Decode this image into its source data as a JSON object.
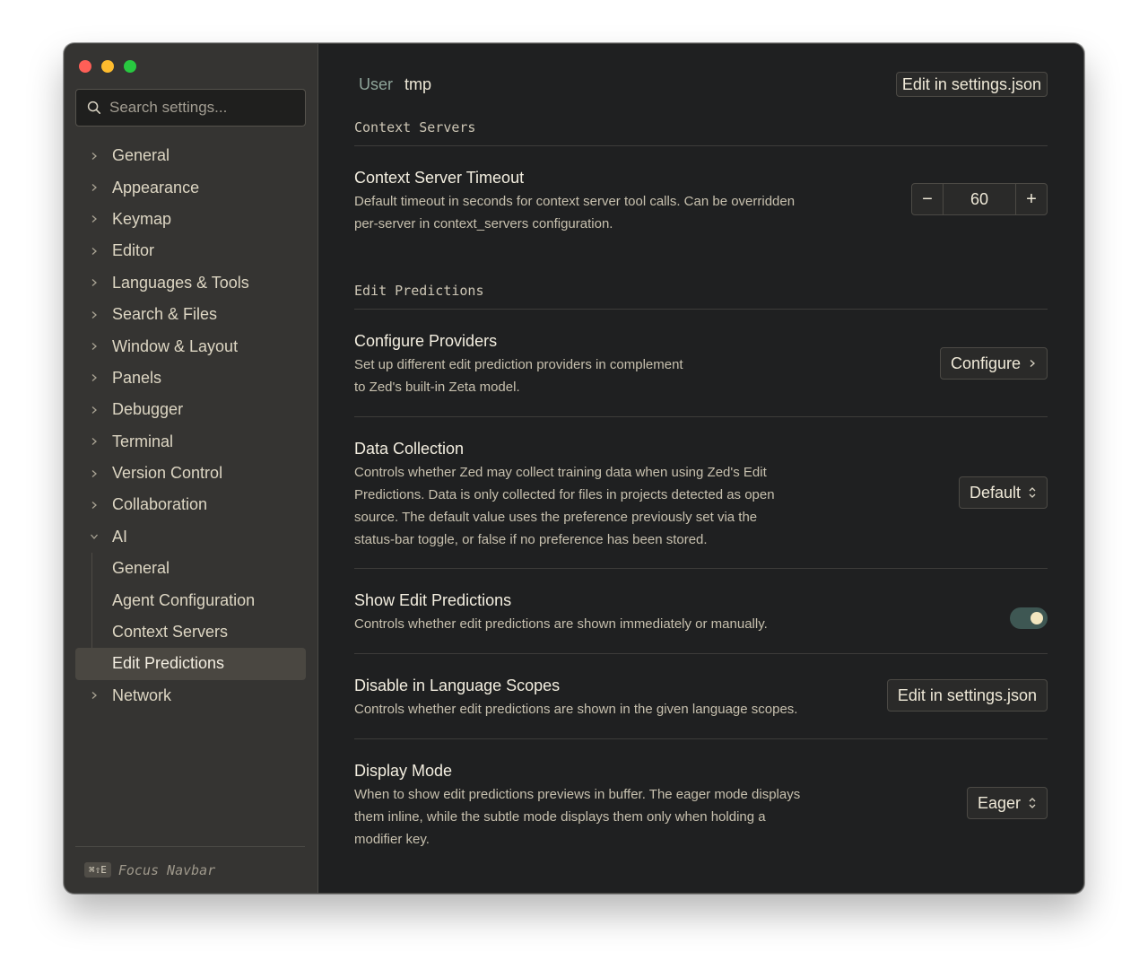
{
  "window": {
    "traffic_lights": [
      "close",
      "minimize",
      "maximize"
    ]
  },
  "sidebar": {
    "search_placeholder": "Search settings...",
    "items": [
      {
        "label": "General",
        "expanded": false
      },
      {
        "label": "Appearance",
        "expanded": false
      },
      {
        "label": "Keymap",
        "expanded": false
      },
      {
        "label": "Editor",
        "expanded": false
      },
      {
        "label": "Languages & Tools",
        "expanded": false
      },
      {
        "label": "Search & Files",
        "expanded": false
      },
      {
        "label": "Window & Layout",
        "expanded": false
      },
      {
        "label": "Panels",
        "expanded": false
      },
      {
        "label": "Debugger",
        "expanded": false
      },
      {
        "label": "Terminal",
        "expanded": false
      },
      {
        "label": "Version Control",
        "expanded": false
      },
      {
        "label": "Collaboration",
        "expanded": false
      },
      {
        "label": "AI",
        "expanded": true
      },
      {
        "label": "Network",
        "expanded": false
      }
    ],
    "ai_children": [
      {
        "label": "General"
      },
      {
        "label": "Agent Configuration"
      },
      {
        "label": "Context Servers"
      },
      {
        "label": "Edit Predictions",
        "active": true
      }
    ],
    "footer": {
      "shortcut": "⌘⇧E",
      "label": "Focus Navbar"
    }
  },
  "main": {
    "breadcrumb": {
      "scope": "User",
      "project": "tmp"
    },
    "header_button": "Edit in settings.json",
    "sections": [
      {
        "title": "Context Servers"
      },
      {
        "title": "Edit Predictions"
      }
    ],
    "settings": {
      "context_server_timeout": {
        "title": "Context Server Timeout",
        "description_lines": [
          "Default timeout in seconds for context server tool calls. Can be overridden",
          "per-server in context_servers configuration."
        ],
        "value": "60",
        "minus": "−",
        "plus": "+"
      },
      "configure_providers": {
        "title": "Configure Providers",
        "description_lines": [
          "Set up different edit prediction providers in complement",
          "to Zed's built-in Zeta model."
        ],
        "button": "Configure"
      },
      "data_collection": {
        "title": "Data Collection",
        "description_lines": [
          "Controls whether Zed may collect training data when using Zed's Edit",
          "Predictions. Data is only collected for files in projects detected as open",
          "source. The default value uses the preference previously set via the",
          "status-bar toggle, or false if no preference has been stored."
        ],
        "selected": "Default"
      },
      "show_edit_predictions": {
        "title": "Show Edit Predictions",
        "description_lines": [
          "Controls whether edit predictions are shown immediately or manually."
        ],
        "enabled": true
      },
      "disable_in_language_scopes": {
        "title": "Disable in Language Scopes",
        "description_lines": [
          "Controls whether edit predictions are shown in the given language scopes."
        ],
        "button": "Edit in settings.json"
      },
      "display_mode": {
        "title": "Display Mode",
        "description_lines": [
          "When to show edit predictions previews in buffer. The eager mode displays",
          "them inline, while the subtle mode displays them only when holding a",
          "modifier key."
        ],
        "selected": "Eager"
      }
    }
  },
  "colors": {
    "sidebar_bg": "#353432",
    "main_bg": "#1f2021",
    "toggle_on": "#3e5753",
    "breadcrumb_scope": "#8fa59a"
  }
}
